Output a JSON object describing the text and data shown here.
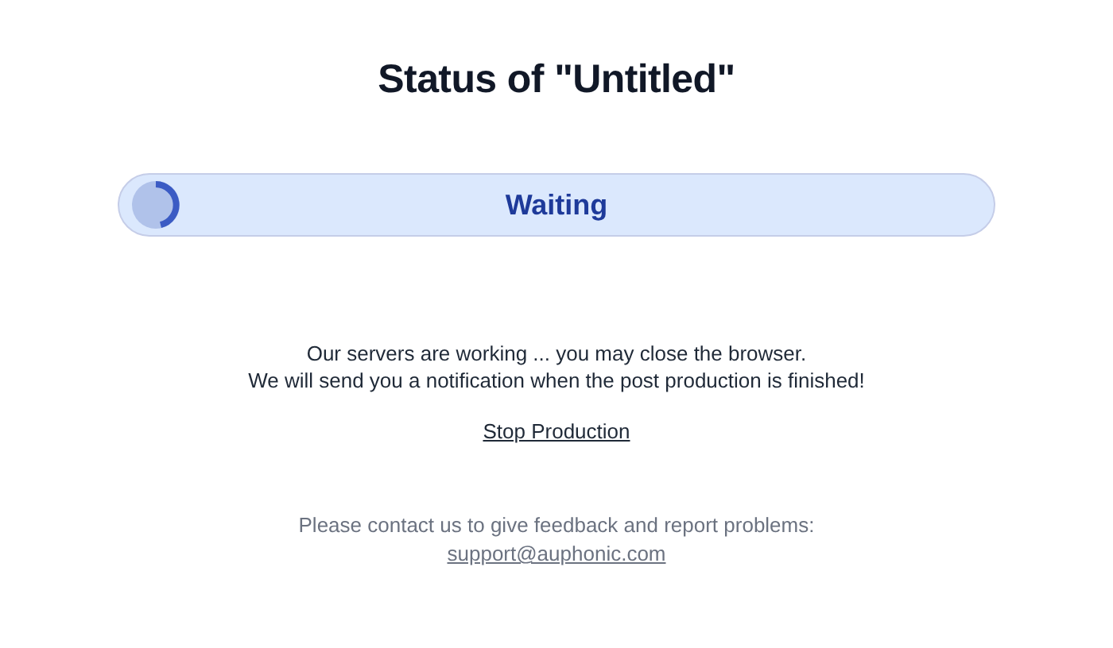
{
  "title": "Status of \"Untitled\"",
  "status": {
    "label": "Waiting"
  },
  "message_lines": [
    "Our servers are working ... you may close the browser.",
    "We will send you a notification when the post production is finished!"
  ],
  "stop_link": "Stop Production",
  "contact": {
    "text": "Please contact us to give feedback and report problems:",
    "email": "support@auphonic.com"
  }
}
